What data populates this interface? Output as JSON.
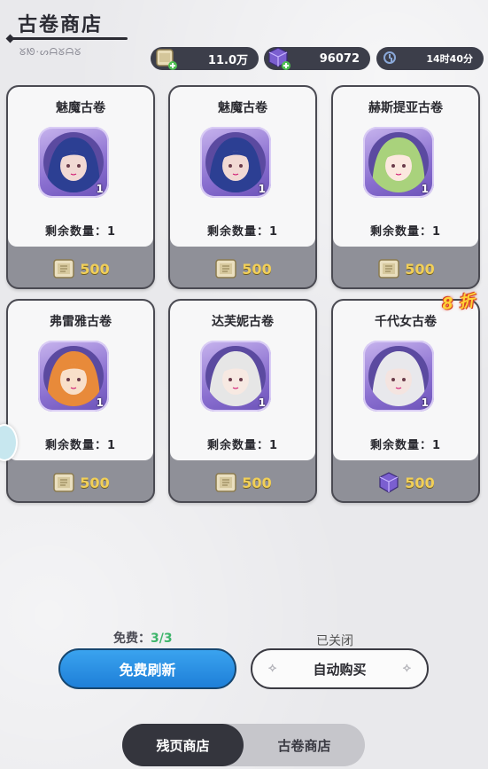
{
  "header": {
    "title": "古卷商店",
    "subtitle": "ᘜᘚ·ᔕᗩᘜᗩᘜ"
  },
  "resources": {
    "scroll_amount": "11.0万",
    "cube_amount": "96072",
    "timer": "14时40分"
  },
  "cards": [
    {
      "name": "魅魔古卷",
      "remain": "剩余数量：1",
      "count": "1",
      "price": "500",
      "currency": "scroll",
      "hair": "#2c3f93",
      "skin": "#f1d9d4"
    },
    {
      "name": "魅魔古卷",
      "remain": "剩余数量：1",
      "count": "1",
      "price": "500",
      "currency": "scroll",
      "hair": "#2c3f93",
      "skin": "#f1d9d4"
    },
    {
      "name": "赫斯提亚古卷",
      "remain": "剩余数量：1",
      "count": "1",
      "price": "500",
      "currency": "scroll",
      "hair": "#a9d27c",
      "skin": "#fbe8df"
    },
    {
      "name": "弗雷雅古卷",
      "remain": "剩余数量：1",
      "count": "1",
      "price": "500",
      "currency": "scroll",
      "hair": "#e88a3a",
      "skin": "#f8dfc9"
    },
    {
      "name": "达芙妮古卷",
      "remain": "剩余数量：1",
      "count": "1",
      "price": "500",
      "currency": "scroll",
      "hair": "#e6e6e6",
      "skin": "#f7e9e2"
    },
    {
      "name": "千代女古卷",
      "remain": "剩余数量：1",
      "count": "1",
      "price": "500",
      "currency": "cube",
      "hair": "#e8e8ec",
      "skin": "#f4e4e0"
    }
  ],
  "discount_badge": "8 折",
  "bottom": {
    "free_label": "免费：",
    "free_ratio": "3/3",
    "refresh_label": "免费刷新",
    "closed_label": "已关闭",
    "auto_buy_label": "自动购买"
  },
  "tabs": {
    "active": "残页商店",
    "other": "古卷商店"
  },
  "colors": {
    "price": "#f1cf58",
    "refresh_button": "#2a8fe3",
    "portrait_frame": "#8a6fd0",
    "discount": "#ffd338"
  }
}
